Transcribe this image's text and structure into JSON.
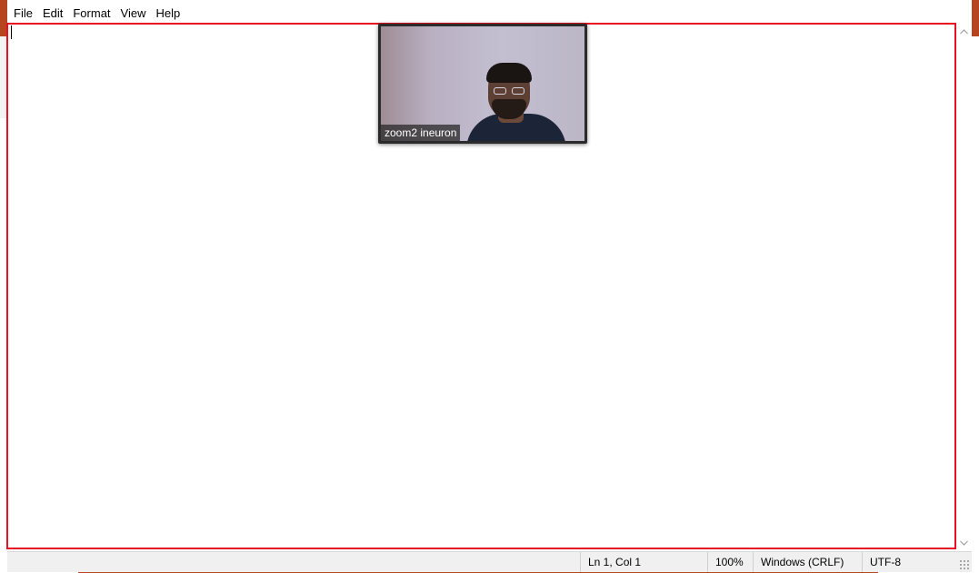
{
  "menu": {
    "items": [
      "File",
      "Edit",
      "Format",
      "View",
      "Help"
    ]
  },
  "editor": {
    "content": "",
    "highlight_color": "#e81123"
  },
  "video": {
    "participant_name": "zoom2 ineuron"
  },
  "statusbar": {
    "position": "Ln 1, Col 1",
    "zoom": "100%",
    "line_ending": "Windows (CRLF)",
    "encoding": "UTF-8"
  },
  "icons": {
    "scroll_up": "chevron-up-icon",
    "scroll_down": "chevron-down-icon",
    "resize": "resize-grip-icon"
  }
}
